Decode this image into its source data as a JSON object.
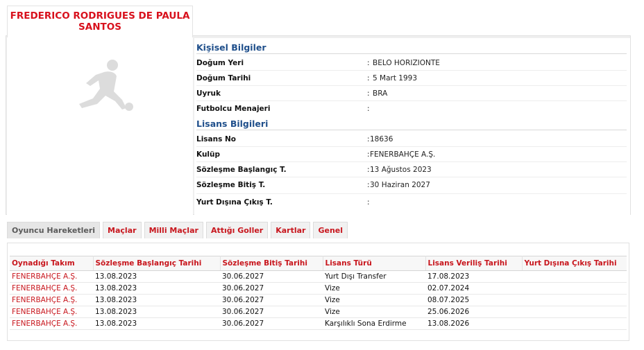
{
  "player": {
    "name_line1": "FREDERICO RODRIGUES DE PAULA",
    "name_line2": "SANTOS",
    "photo_icon": "player-silhouette-icon"
  },
  "personal": {
    "title": "Kişisel Bilgiler",
    "rows": [
      {
        "label": "Doğum Yeri",
        "colon": ":",
        "value": "BELO HORIZIONTE"
      },
      {
        "label": "Doğum Tarihi",
        "colon": ":",
        "value": "5 Mart 1993"
      },
      {
        "label": "Uyruk",
        "colon": ":",
        "value": "BRA"
      },
      {
        "label": "Futbolcu Menajeri",
        "colon": ":",
        "value": ""
      }
    ]
  },
  "license": {
    "title": "Lisans Bilgileri",
    "rows": [
      {
        "label": "Lisans No",
        "colon": ":",
        "value": "18636"
      },
      {
        "label": "Kulüp",
        "colon": ":",
        "value": "FENERBAHÇE A.Ş."
      },
      {
        "label": "Sözleşme Başlangıç T.",
        "colon": ":",
        "value": "13 Ağustos 2023"
      },
      {
        "label": "Sözleşme Bitiş T.",
        "colon": ":",
        "value": "30 Haziran 2027"
      },
      {
        "label": "Yurt Dışına Çıkış T.",
        "colon": ":",
        "value": ""
      }
    ]
  },
  "tabs": [
    {
      "label": "Oyuncu Hareketleri",
      "active": true
    },
    {
      "label": "Maçlar",
      "active": false
    },
    {
      "label": "Milli Maçlar",
      "active": false
    },
    {
      "label": "Attığı Goller",
      "active": false
    },
    {
      "label": "Kartlar",
      "active": false
    },
    {
      "label": "Genel",
      "active": false
    }
  ],
  "movements": {
    "headers": [
      "Oynadığı Takım",
      "Sözleşme Başlangıç Tarihi",
      "Sözleşme Bitiş Tarihi",
      "Lisans Türü",
      "Lisans Veriliş Tarihi",
      "Yurt Dışına Çıkış Tarihi"
    ],
    "rows": [
      [
        "FENERBAHÇE A.Ş.",
        "13.08.2023",
        "30.06.2027",
        "Yurt Dışı Transfer",
        "17.08.2023",
        ""
      ],
      [
        "FENERBAHÇE A.Ş.",
        "13.08.2023",
        "30.06.2027",
        "Vize",
        "02.07.2024",
        ""
      ],
      [
        "FENERBAHÇE A.Ş.",
        "13.08.2023",
        "30.06.2027",
        "Vize",
        "08.07.2025",
        ""
      ],
      [
        "FENERBAHÇE A.Ş.",
        "13.08.2023",
        "30.06.2027",
        "Vize",
        "25.06.2026",
        ""
      ],
      [
        "FENERBAHÇE A.Ş.",
        "13.08.2023",
        "30.06.2027",
        "Karşılıklı Sona Erdirme",
        "13.08.2026",
        ""
      ]
    ]
  },
  "colors": {
    "accent_red": "#c8161d",
    "section_blue": "#1f4f8b"
  }
}
